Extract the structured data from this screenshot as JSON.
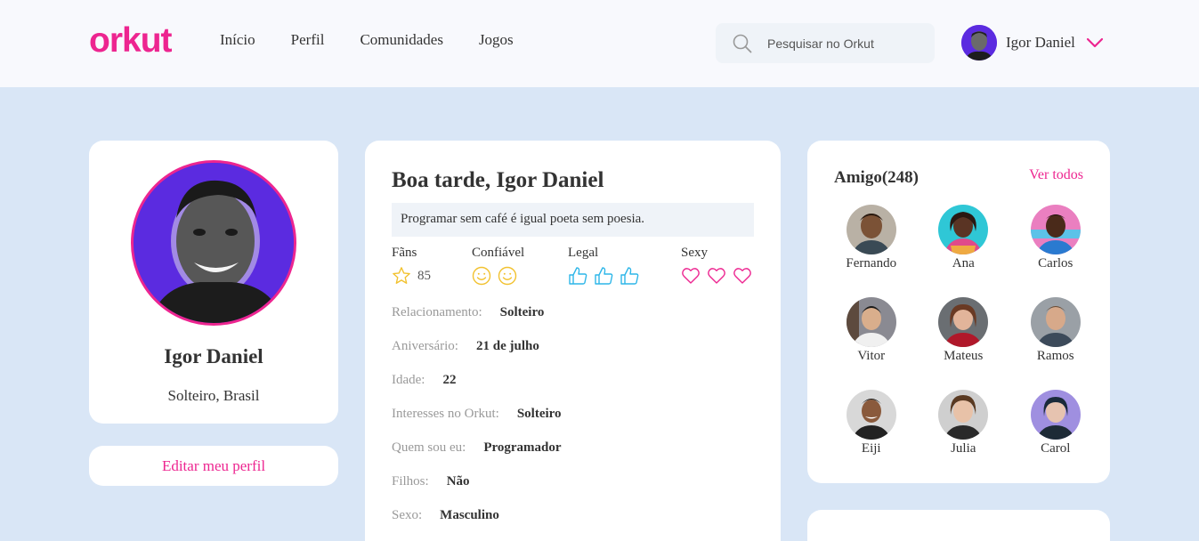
{
  "header": {
    "logo": "orkut",
    "nav": [
      "Início",
      "Perfil",
      "Comunidades",
      "Jogos"
    ],
    "search_placeholder": "Pesquisar no Orkut",
    "user_name": "Igor Daniel"
  },
  "profile": {
    "name": "Igor Daniel",
    "subtitle": "Solteiro, Brasil",
    "edit_label": "Editar meu perfil"
  },
  "main": {
    "greeting": "Boa tarde, Igor Daniel",
    "quote": "Programar sem café é igual poeta sem poesia.",
    "stats": {
      "fans_label": "Fãns",
      "fans_count": "85",
      "trust_label": "Confiável",
      "trust_level": 2,
      "cool_label": "Legal",
      "cool_level": 3,
      "sexy_label": "Sexy",
      "sexy_level": 3
    },
    "info": [
      {
        "label": "Relacionamento:",
        "value": "Solteiro"
      },
      {
        "label": "Aniversário:",
        "value": "21 de julho"
      },
      {
        "label": "Idade:",
        "value": "22"
      },
      {
        "label": "Interesses no Orkut:",
        "value": "Solteiro"
      },
      {
        "label": "Quem sou eu:",
        "value": "Programador"
      },
      {
        "label": "Filhos:",
        "value": "Não"
      },
      {
        "label": "Sexo:",
        "value": "Masculino"
      }
    ]
  },
  "friends": {
    "title": "Amigo(248)",
    "see_all": "Ver todos",
    "list": [
      {
        "name": "Fernando"
      },
      {
        "name": "Ana"
      },
      {
        "name": "Carlos"
      },
      {
        "name": "Vitor"
      },
      {
        "name": "Mateus"
      },
      {
        "name": "Ramos"
      },
      {
        "name": "Eiji"
      },
      {
        "name": "Julia"
      },
      {
        "name": "Carol"
      }
    ]
  },
  "colors": {
    "brand": "#ED2590",
    "background": "#D9E6F6",
    "avatar_bg": "#5B2BE0",
    "emoji_yellow": "#F2C230",
    "thumb_blue": "#2DB6E8"
  }
}
